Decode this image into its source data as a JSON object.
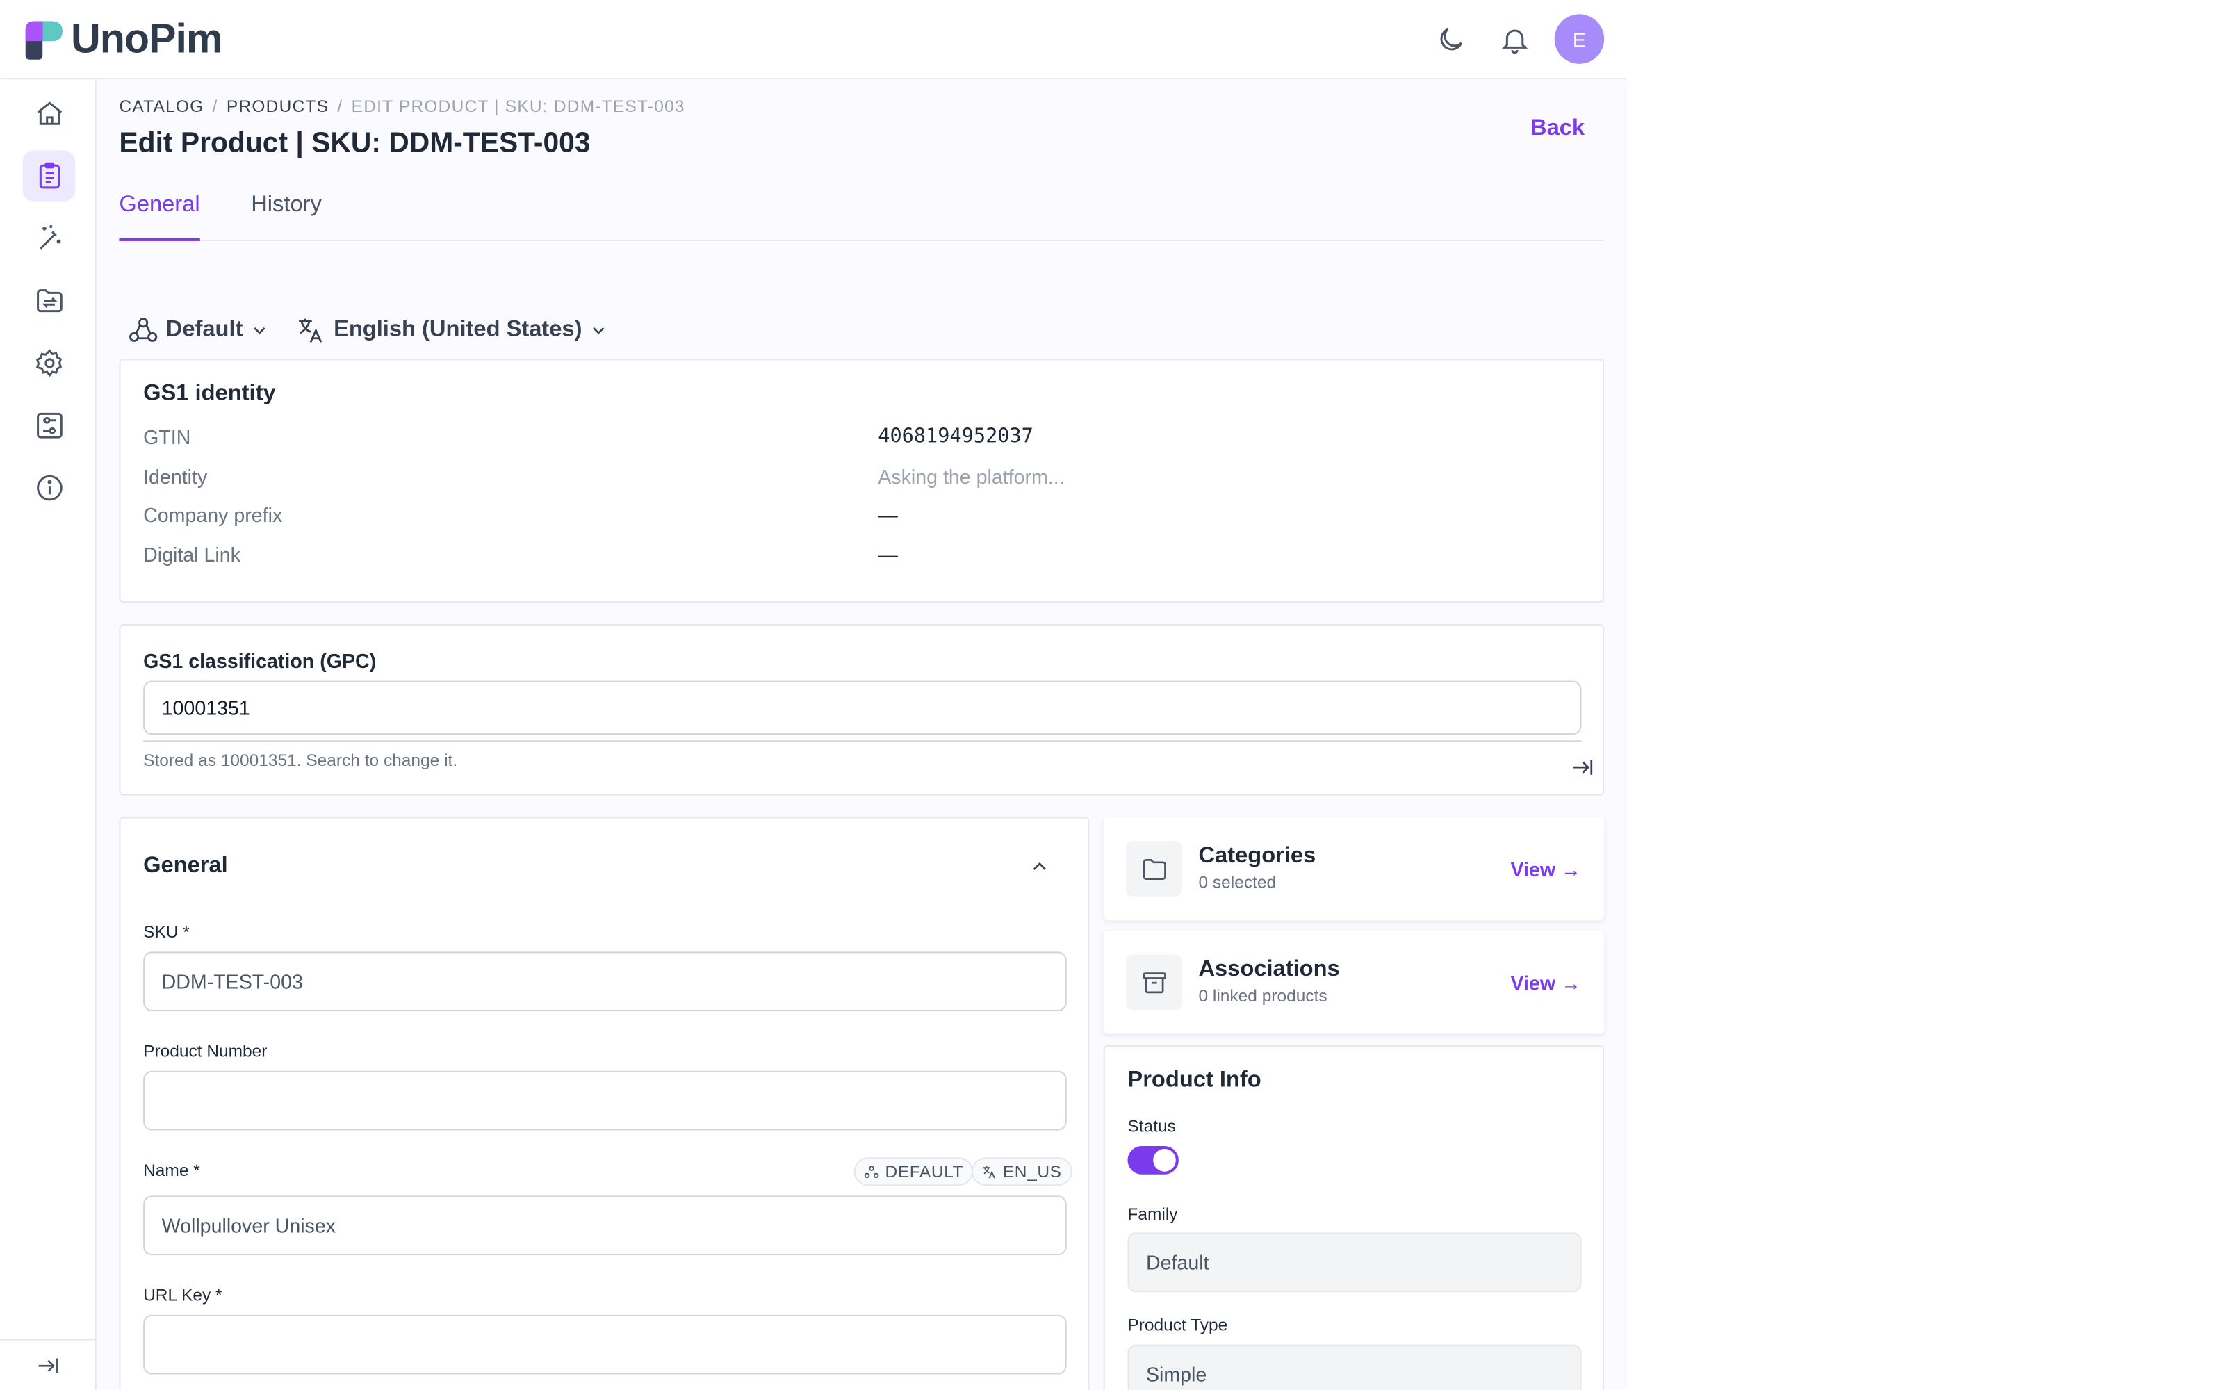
{
  "app": {
    "name": "UnoPim",
    "avatar_initial": "E",
    "header_icons": [
      "moon-icon",
      "bell-icon"
    ]
  },
  "sidebar": {
    "items": [
      {
        "name": "dashboard",
        "icon": "home-icon"
      },
      {
        "name": "catalog",
        "icon": "clipboard-list-icon",
        "active": true
      },
      {
        "name": "magic",
        "icon": "magic-wand-icon"
      },
      {
        "name": "data-transfer",
        "icon": "folder-transfer-icon"
      },
      {
        "name": "settings",
        "icon": "gear-icon"
      },
      {
        "name": "configuration",
        "icon": "sliders-icon"
      },
      {
        "name": "about",
        "icon": "info-icon"
      }
    ],
    "collapse_icon": "collapse-arrow-icon"
  },
  "breadcrumb": {
    "items": [
      "CATALOG",
      "PRODUCTS",
      "EDIT PRODUCT | SKU: DDM-TEST-003"
    ],
    "sep": "/"
  },
  "page": {
    "title": "Edit Product | SKU: DDM-TEST-003",
    "back_label": "Back"
  },
  "tabs": [
    {
      "label": "General",
      "active": true
    },
    {
      "label": "History",
      "active": false
    }
  ],
  "selectors": {
    "channel": "Default",
    "locale": "English (United States)"
  },
  "gs1_identity": {
    "title": "GS1 identity",
    "rows": [
      {
        "label": "GTIN",
        "value": "4068194952037"
      },
      {
        "label": "Identity",
        "value": "Asking the platform..."
      },
      {
        "label": "Company prefix",
        "value": "—"
      },
      {
        "label": "Digital Link",
        "value": "—"
      }
    ]
  },
  "gs1_classification": {
    "title": "GS1 classification (GPC)",
    "value": "10001351",
    "helper": "Stored as 10001351. Search to change it."
  },
  "general": {
    "title": "General",
    "sku": {
      "label": "SKU *",
      "value": "DDM-TEST-003"
    },
    "product_number": {
      "label": "Product Number",
      "value": ""
    },
    "name": {
      "label": "Name *",
      "value": "Wollpullover Unisex",
      "chips": [
        "DEFAULT",
        "EN_US"
      ]
    },
    "url_key": {
      "label": "URL Key *",
      "value": ""
    }
  },
  "categories": {
    "title": "Categories",
    "sub": "0 selected",
    "link": "View →"
  },
  "associations": {
    "title": "Associations",
    "sub": "0 linked products",
    "link": "View →"
  },
  "product_info": {
    "title": "Product Info",
    "status": {
      "label": "Status",
      "enabled": true
    },
    "family": {
      "label": "Family",
      "value": "Default"
    },
    "product_type": {
      "label": "Product Type",
      "value": "Simple"
    }
  },
  "colors": {
    "accent": "#7c3aed",
    "avatar": "#a78bfa"
  }
}
